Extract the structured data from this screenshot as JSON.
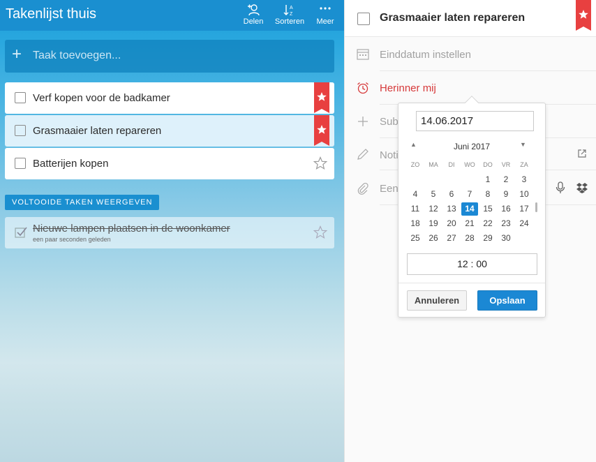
{
  "left": {
    "list_title": "Takenlijst thuis",
    "toolbar": {
      "share_label": "Delen",
      "sort_label": "Sorteren",
      "more_label": "Meer"
    },
    "add_task": {
      "placeholder": "Taak toevoegen..."
    },
    "tasks": [
      {
        "title": "Verf kopen voor de badkamer",
        "starred": true
      },
      {
        "title": "Grasmaaier laten repareren",
        "starred": true,
        "selected": true
      },
      {
        "title": "Batterijen kopen",
        "starred": false
      }
    ],
    "show_completed_label": "VOLTOOIDE TAKEN WEERGEVEN",
    "completed_tasks": [
      {
        "title": "Nieuwe lampen plaatsen in de woonkamer",
        "subtitle": "een paar seconden geleden"
      }
    ]
  },
  "detail": {
    "title": "Grasmaaier laten repareren",
    "due_date_label": "Einddatum instellen",
    "reminder_label": "Herinner mij",
    "subtask_label": "Subt",
    "note_label": "Noti",
    "file_label": "Een"
  },
  "reminder_popup": {
    "date_value": "14.06.2017",
    "month_label": "Juni 2017",
    "weekdays": [
      "ZO",
      "MA",
      "DI",
      "WO",
      "DO",
      "VR",
      "ZA"
    ],
    "weeks": [
      [
        "",
        "",
        "",
        "",
        "1",
        "2",
        "3"
      ],
      [
        "4",
        "5",
        "6",
        "7",
        "8",
        "9",
        "10"
      ],
      [
        "11",
        "12",
        "13",
        "14",
        "15",
        "16",
        "17"
      ],
      [
        "18",
        "19",
        "20",
        "21",
        "22",
        "23",
        "24"
      ],
      [
        "25",
        "26",
        "27",
        "28",
        "29",
        "30",
        ""
      ]
    ],
    "selected_day": "14",
    "time_value": "12 : 00",
    "cancel_label": "Annuleren",
    "save_label": "Opslaan"
  },
  "colors": {
    "accent_blue": "#1b88d4",
    "star_red": "#e84040",
    "reminder_red": "#d6393a"
  }
}
